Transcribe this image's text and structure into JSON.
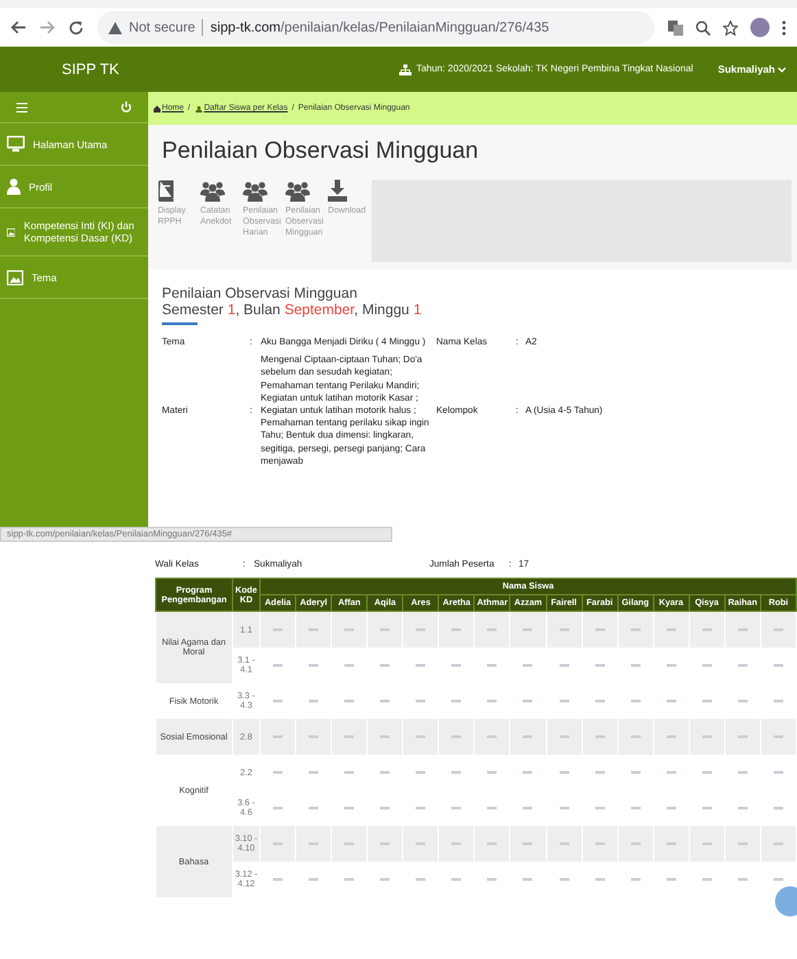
{
  "browser": {
    "security": "Not secure",
    "url_host": "sipp-tk.com",
    "url_path": "/penilaian/kelas/PenilaianMingguan/276/435"
  },
  "header": {
    "brand": "SIPP TK",
    "info": "Tahun: 2020/2021 Sekolah: TK Negeri Pembina Tingkat Nasional",
    "user": "Sukmaliyah"
  },
  "sidebar": {
    "items": [
      {
        "label": "Halaman Utama",
        "kind": "monitor"
      },
      {
        "label": "Profil",
        "kind": "person"
      },
      {
        "label": "Kompetensi Inti (KI) dan Kompetensi Dasar (KD)",
        "kind": "image"
      },
      {
        "label": "Tema",
        "kind": "image"
      }
    ]
  },
  "breadcrumb": [
    {
      "label": "Home",
      "kind": "home"
    },
    {
      "label": "/",
      "kind": "separator"
    },
    {
      "label": "Daftar Siswa per Kelas",
      "kind": "group"
    },
    {
      "label": "/",
      "kind": "separator"
    },
    {
      "label": "Penilaian Observasi Mingguan",
      "kind": "current"
    }
  ],
  "page_title": "Penilaian Observasi Mingguan",
  "toolbar": [
    {
      "label": "Display RPPH",
      "kind": "book"
    },
    {
      "label": "Catatan Anekdot",
      "kind": "group"
    },
    {
      "label": "Penilaian Observasi Harian",
      "kind": "group"
    },
    {
      "label": "Penilaian Observasi Mingguan",
      "kind": "group"
    },
    {
      "label": "Download",
      "kind": "download"
    }
  ],
  "section": {
    "title": "Penilaian Observasi Mingguan",
    "subtitle": [
      {
        "text": "Semester ",
        "highlight": false
      },
      {
        "text": "1",
        "highlight": true
      },
      {
        "text": ", Bulan ",
        "highlight": false
      },
      {
        "text": "September",
        "highlight": true
      },
      {
        "text": ", Minggu ",
        "highlight": false
      },
      {
        "text": "1",
        "highlight": true
      }
    ]
  },
  "info": [
    {
      "label": "Tema",
      "sep": ":",
      "value": "Aku Bangga Menjadi Diriku ( 4 Minggu )",
      "label2": "Nama Kelas",
      "sep2": ":",
      "value2": "A2"
    },
    {
      "label": "Materi",
      "sep": ":",
      "value": "Mengenal Ciptaan-ciptaan Tuhan; Do'a sebelum dan sesudah kegiatan; Pemahaman tentang Perilaku Mandiri; Kegiatan untuk latihan motorik Kasar ; Kegiatan untuk latihan motorik halus ; Pemahaman tentang perilaku sikap ingin Tahu; Bentuk dua dimensi: lingkaran, segitiga, persegi, persegi panjang; Cara menjawab",
      "label2": "Kelompok",
      "sep2": ":",
      "value2": "A (Usia 4-5 Tahun)"
    },
    {
      "label": "Wali Kelas",
      "sep": ":",
      "value": "Sukmaliyah",
      "label2": "Jumlah Peserta",
      "sep2": ":",
      "value2": "17"
    }
  ],
  "status_url": "sipp-tk.com/penilaian/kelas/PenilaianMingguan/276/435#",
  "table": {
    "program_header": "Program Pengembangan",
    "code_header": "Kode KD",
    "students_header": "Nama Siswa",
    "students": [
      "Adelia",
      "Aderyl",
      "Affan",
      "Aqila",
      "Ares",
      "Aretha",
      "Athmar",
      "Azzam",
      "Fairell",
      "Farabi",
      "Gilang",
      "Kyara",
      "Qisya",
      "Raihan",
      "Robi"
    ],
    "rows": [
      {
        "program": "Nilai Agama dan Moral",
        "codes": [
          "1.1",
          "3.1 - 4.1"
        ]
      },
      {
        "program": "Fisik Motorik",
        "codes": [
          "3.3 - 4.3"
        ]
      },
      {
        "program": "Sosial Emosional",
        "codes": [
          "2.8"
        ]
      },
      {
        "program": "Kognitif",
        "codes": [
          "2.2",
          "3.6 - 4.6"
        ]
      },
      {
        "program": "Bahasa",
        "codes": [
          "3.10 - 4.10",
          "3.12 - 4.12"
        ]
      }
    ]
  }
}
